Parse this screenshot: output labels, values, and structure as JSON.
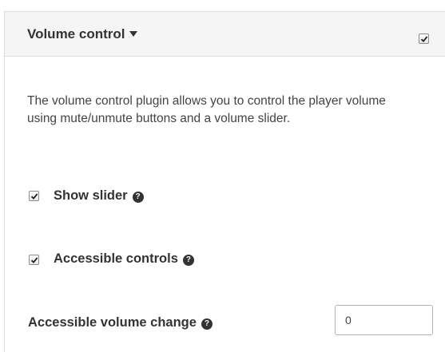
{
  "panel": {
    "title": "Volume control",
    "enabled": true,
    "description": "The volume control plugin allows you to control the player volume using mute/unmute buttons and a volume slider."
  },
  "options": {
    "show_slider": {
      "label": "Show slider",
      "checked": true
    },
    "accessible_controls": {
      "label": "Accessible controls",
      "checked": true
    },
    "accessible_volume_change": {
      "label": "Accessible volume change",
      "value": "0"
    }
  },
  "icons": {
    "caret": "caret-down-icon",
    "help": "question-circle-icon",
    "check": "checkmark-icon"
  }
}
